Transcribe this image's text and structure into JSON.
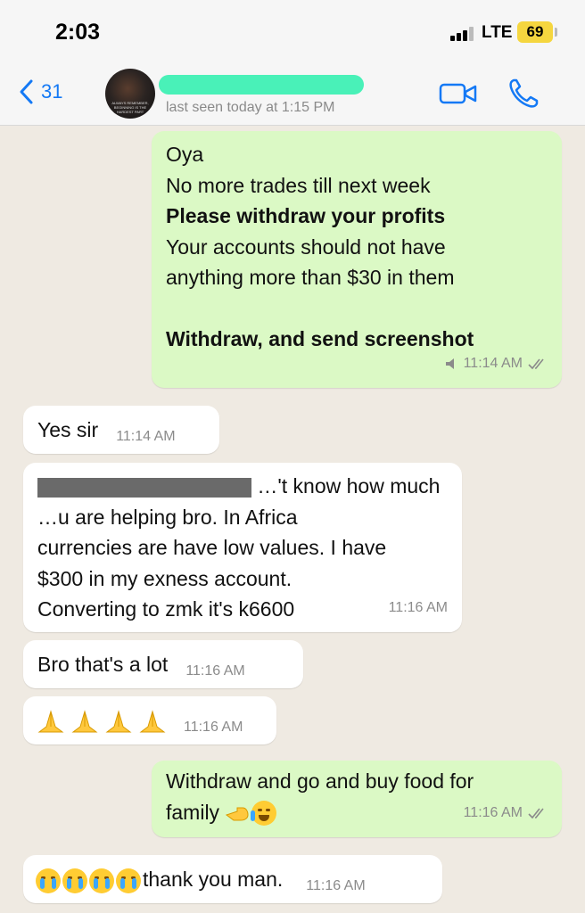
{
  "status_bar": {
    "time": "2:03",
    "network": "LTE",
    "battery": "69"
  },
  "header": {
    "back_count": "31",
    "last_seen": "last seen today at 1:15 PM",
    "avatar_text": "ALWAYS REMEMBER, BEGINNING IS THE HARDEST PART"
  },
  "messages": [
    {
      "direction": "out",
      "lines": [
        "Oya",
        "No more trades till next week",
        " Please withdraw your profits",
        "Your accounts should not have",
        "anything more than $30 in them",
        "",
        " Withdraw, and send screenshot"
      ],
      "time": "11:14 AM"
    },
    {
      "direction": "in",
      "text": "Yes sir",
      "time": "11:14 AM"
    },
    {
      "direction": "in",
      "lines": [
        "…'t know how much",
        "…u are helping bro. In Africa",
        "currencies are have low values. I have",
        "$300 in my exness account.",
        "Converting to zmk it's k6600"
      ],
      "time": "11:16 AM"
    },
    {
      "direction": "in",
      "text": "Bro that's a lot",
      "time": "11:16 AM"
    },
    {
      "direction": "in",
      "emojis": [
        "folded-hands",
        "folded-hands",
        "folded-hands",
        "folded-hands"
      ],
      "time": "11:16 AM"
    },
    {
      "direction": "out",
      "lines": [
        "Withdraw and go and buy food for",
        "family"
      ],
      "time": "11:16 AM"
    },
    {
      "direction": "in",
      "emojis": [
        "crying",
        "crying",
        "crying",
        "crying"
      ],
      "text": "thank you man.",
      "time": "11:16 AM"
    }
  ],
  "colors": {
    "outgoing": "#dbf9c5",
    "incoming": "#ffffff",
    "accent": "#1479f5",
    "battery": "#f5d63f"
  }
}
